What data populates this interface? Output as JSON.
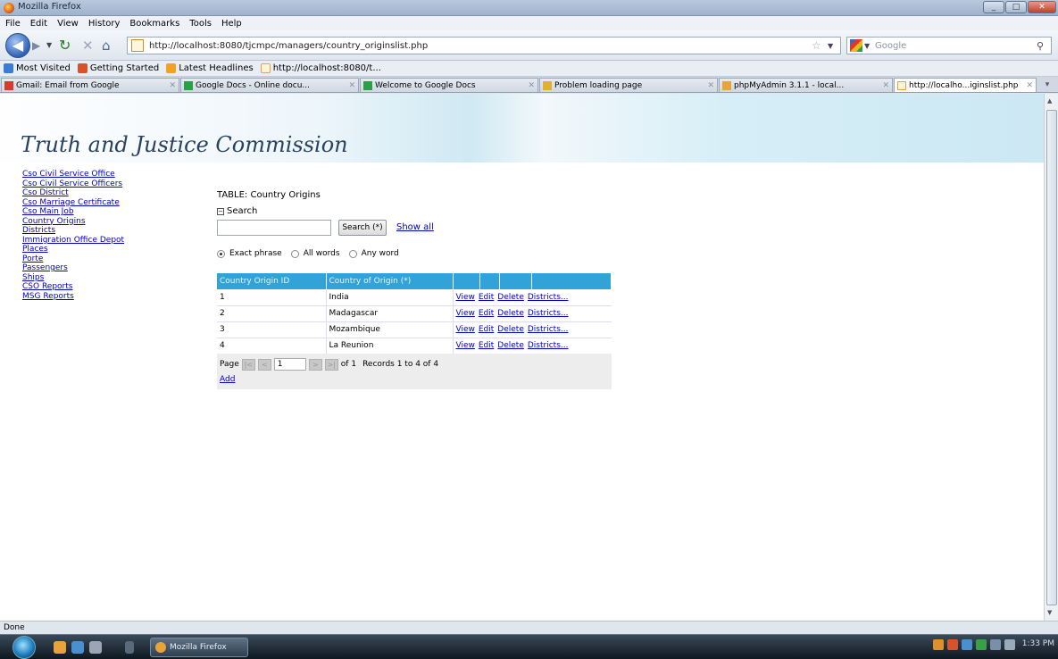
{
  "window": {
    "title": "Mozilla Firefox",
    "controls": {
      "minimize": "_",
      "maximize": "□",
      "close": "✕"
    }
  },
  "menu": [
    "File",
    "Edit",
    "View",
    "History",
    "Bookmarks",
    "Tools",
    "Help"
  ],
  "nav": {
    "url": "http://localhost:8080/tjcmpc/managers/country_originslist.php",
    "search_placeholder": "Google",
    "icons": {
      "back": "back-arrow-icon",
      "forward": "forward-arrow-icon",
      "reload": "reload-icon",
      "stop": "stop-icon",
      "home": "home-icon",
      "star": "bookmark-star-icon",
      "search": "magnifier-icon"
    }
  },
  "bookmarks": [
    {
      "label": "Most Visited",
      "color": "#3a7bd5"
    },
    {
      "label": "Getting Started",
      "color": "#d9532a"
    },
    {
      "label": "Latest Headlines",
      "color": "#f1a21e"
    },
    {
      "label": "http://localhost:8080/t...",
      "color": "#e8a33a"
    }
  ],
  "tabs": [
    {
      "label": "Gmail: Email from Google",
      "color": "#d93a2a",
      "active": false
    },
    {
      "label": "Google Docs - Online docu...",
      "color": "#2aa046",
      "active": false
    },
    {
      "label": "Welcome to Google Docs",
      "color": "#2aa046",
      "active": false
    },
    {
      "label": "Problem loading page",
      "color": "#e0b030",
      "active": false
    },
    {
      "label": "phpMyAdmin 3.1.1 - local...",
      "color": "#e8a33a",
      "active": false
    },
    {
      "label": "http://localho...iginslist.php",
      "color": "#e8a33a",
      "active": true
    }
  ],
  "site": {
    "title": "Truth and Justice Commission",
    "sidebar_links": [
      "Cso Civil Service Office",
      "Cso Civil Service Officers",
      "Cso District",
      "Cso Marriage Certificate",
      "Cso Main Job",
      "Country Origins",
      "Districts",
      "Immigration Office Depot",
      "Places",
      "Porte",
      "Passengers",
      "Ships",
      "CSO Reports",
      "MSG Reports"
    ]
  },
  "table_page": {
    "title": "TABLE: Country Origins",
    "search_toggle": "Search",
    "search_value": "",
    "search_button": "Search (*)",
    "show_all": "Show all",
    "radio_options": [
      {
        "label": "Exact phrase",
        "checked": true
      },
      {
        "label": "All words",
        "checked": false
      },
      {
        "label": "Any word",
        "checked": false
      }
    ],
    "columns": [
      "Country Origin ID",
      "Country of Origin (*)",
      "",
      "",
      "",
      ""
    ],
    "rows": [
      {
        "id": "1",
        "name": "India"
      },
      {
        "id": "2",
        "name": "Madagascar"
      },
      {
        "id": "3",
        "name": "Mozambique"
      },
      {
        "id": "4",
        "name": "La Reunion"
      }
    ],
    "row_actions": {
      "view": "View",
      "edit": "Edit",
      "delete": "Delete",
      "districts": "Districts..."
    },
    "pager": {
      "page_label": "Page",
      "page_value": "1",
      "of_text": "of 1",
      "records": "Records 1 to 4 of 4",
      "first": "|<",
      "prev": "<",
      "next": ">",
      "last": ">|",
      "add": "Add"
    }
  },
  "status": "Done",
  "taskbar": {
    "task": "Mozilla Firefox",
    "clock": "1:33 PM"
  },
  "colors": {
    "header_blue": "#32a3d9",
    "link": "#0000cc",
    "banner_text": "#27435f"
  }
}
